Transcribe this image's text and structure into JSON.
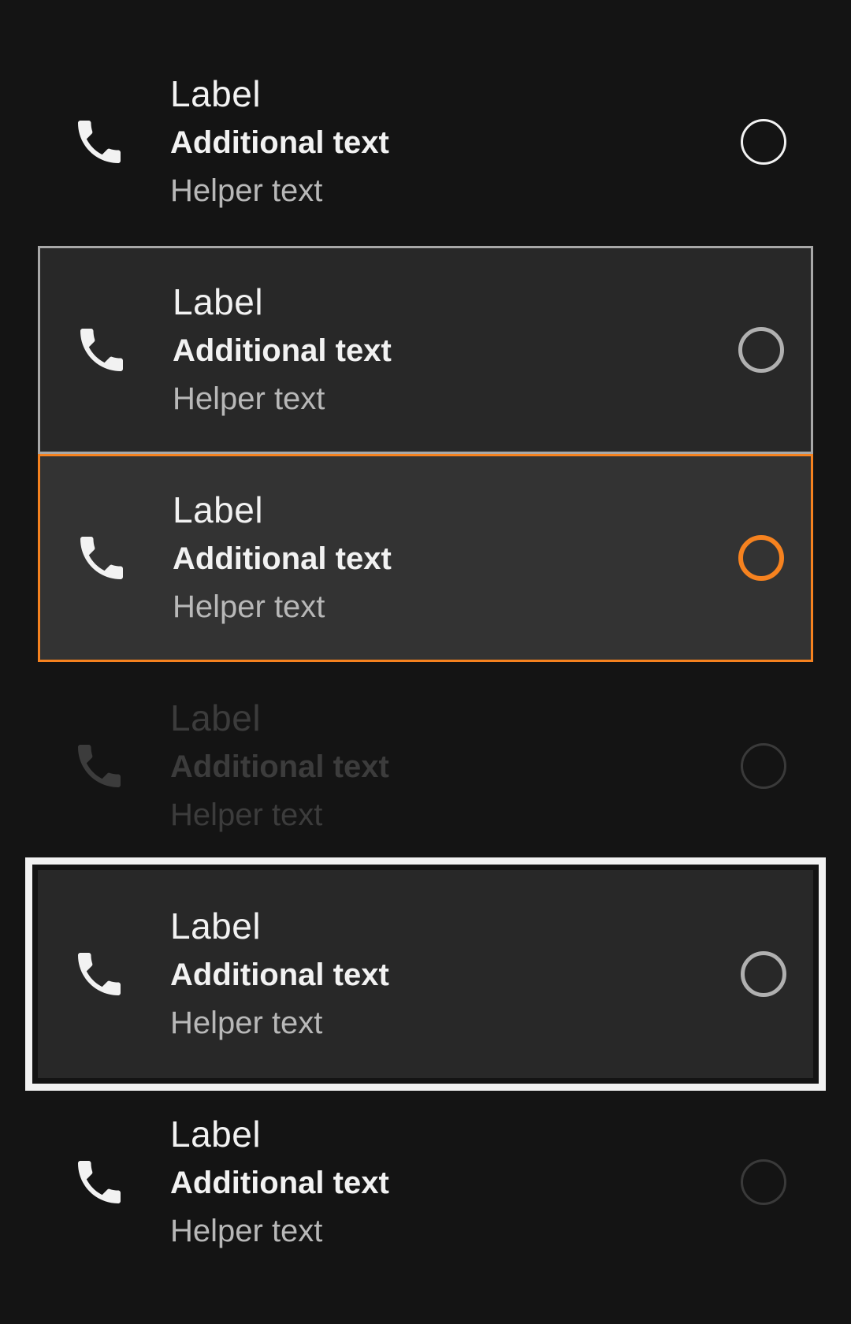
{
  "colors": {
    "background": "#141414",
    "accent": "#f6821f",
    "text_primary": "#f2f2f2",
    "text_secondary": "#b8b8b8",
    "disabled": "#3c3c3c"
  },
  "items": [
    {
      "state": "default",
      "icon": "phone-icon",
      "label": "Label",
      "additional": "Additional text",
      "helper": "Helper text",
      "radio": "unselected"
    },
    {
      "state": "hover",
      "icon": "phone-icon",
      "label": "Label",
      "additional": "Additional text",
      "helper": "Helper text",
      "radio": "unselected"
    },
    {
      "state": "selected",
      "icon": "phone-icon",
      "label": "Label",
      "additional": "Additional text",
      "helper": "Helper text",
      "radio": "highlighted"
    },
    {
      "state": "disabled",
      "icon": "phone-icon",
      "label": "Label",
      "additional": "Additional text",
      "helper": "Helper text",
      "radio": "unselected"
    },
    {
      "state": "focused",
      "icon": "phone-icon",
      "label": "Label",
      "additional": "Additional text",
      "helper": "Helper text",
      "radio": "unselected"
    },
    {
      "state": "default",
      "icon": "phone-icon",
      "label": "Label",
      "additional": "Additional text",
      "helper": "Helper text",
      "radio": "unselected"
    }
  ]
}
